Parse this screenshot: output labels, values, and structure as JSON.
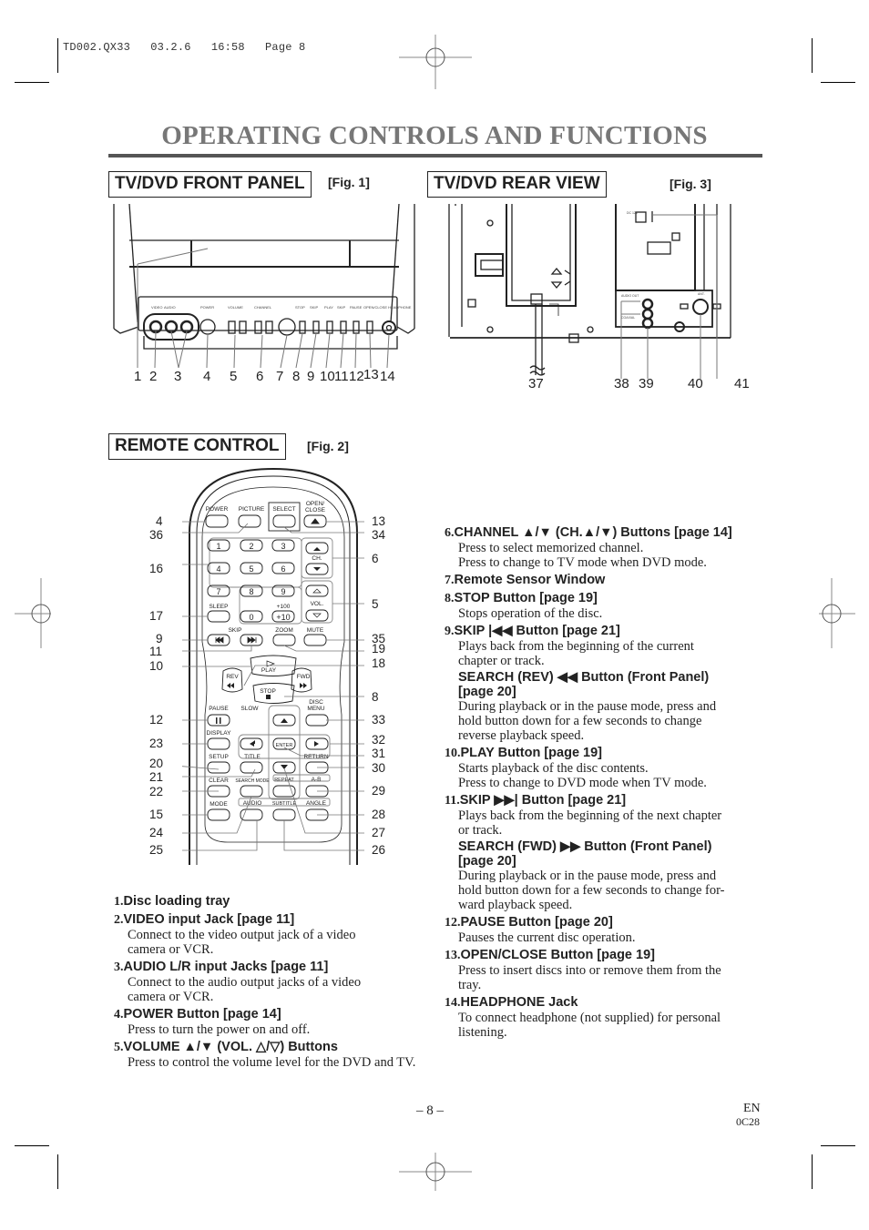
{
  "slug": "TD002.QX33   03.2.6   16:58   Page 8",
  "page_title": "OPERATING CONTROLS AND FUNCTIONS",
  "sections": {
    "front_panel": {
      "heading": "TV/DVD FRONT PANEL",
      "fig": "[Fig. 1]",
      "callouts": [
        "1",
        "2",
        "3",
        "4",
        "5",
        "6",
        "7",
        "8",
        "9",
        "10",
        "11",
        "12",
        "13",
        "14"
      ]
    },
    "rear_view": {
      "heading": "TV/DVD REAR VIEW",
      "fig": "[Fig. 3]",
      "callouts": [
        "37",
        "38",
        "39",
        "40",
        "41"
      ],
      "labels": {
        "dc": "DC 12V",
        "audio_out": "AUDIO OUT",
        "l": "L",
        "r": "R",
        "coaxial": "COAXIAL",
        "ant": "ANT."
      }
    },
    "remote": {
      "heading": "REMOTE CONTROL",
      "fig": "[Fig. 2]",
      "buttons": {
        "power": "POWER",
        "picture": "PICTURE",
        "select": "SELECT",
        "open_close_1": "OPEN/",
        "open_close_2": "CLOSE",
        "digits": [
          "1",
          "2",
          "3",
          "4",
          "5",
          "6",
          "7",
          "8",
          "9"
        ],
        "zero": "0",
        "plus10": "+10",
        "plus100": "+100",
        "sleep": "SLEEP",
        "ch": "CH.",
        "vol": "VOL.",
        "skip": "SKIP",
        "zoom": "ZOOM",
        "mute": "MUTE",
        "play": "PLAY",
        "rev": "REV",
        "fwd": "FWD",
        "stop": "STOP",
        "slow": "SLOW",
        "pause": "PAUSE",
        "disc_menu_1": "DISC",
        "disc_menu_2": "MENU",
        "display": "DISPLAY",
        "enter": "ENTER",
        "setup": "SETUP",
        "title": "TITLE",
        "return": "RETURN",
        "clear": "CLEAR",
        "search_mode": "SEARCH MODE",
        "repeat": "REPEAT",
        "ab": "A-B",
        "mode": "MODE",
        "audio": "AUDIO",
        "subtitle": "SUBTITLE",
        "angle": "ANGLE"
      },
      "left_callouts": [
        "4",
        "36",
        "16",
        "17",
        "9",
        "11",
        "10",
        "12",
        "23",
        "20",
        "21",
        "22",
        "15",
        "24",
        "25"
      ],
      "right_callouts": [
        "13",
        "34",
        "6",
        "5",
        "35",
        "19",
        "18",
        "8",
        "33",
        "32",
        "31",
        "30",
        "29",
        "28",
        "27",
        "26"
      ]
    }
  },
  "items_left": [
    {
      "num": "1.",
      "title": "Disc loading tray",
      "desc": []
    },
    {
      "num": "2.",
      "title": "VIDEO input Jack [page 11]",
      "desc": [
        "Connect to the video output jack of a video",
        "camera or VCR."
      ]
    },
    {
      "num": "3.",
      "title": "AUDIO L/R input Jacks [page 11]",
      "desc": [
        "Connect to the audio output jacks of a video",
        "camera or VCR."
      ]
    },
    {
      "num": "4.",
      "title": "POWER Button [page 14]",
      "desc": [
        "Press to turn the power on and off."
      ]
    },
    {
      "num": "5.",
      "title": "VOLUME ▲/▼ (VOL. △/▽) Buttons",
      "desc": [
        "Press to control the volume level for the DVD and TV."
      ]
    }
  ],
  "items_right": [
    {
      "num": "6.",
      "title": "CHANNEL ▲/▼ (CH.▲/▼) Buttons [page 14]",
      "desc": [
        "Press to select memorized channel.",
        "Press to change to TV mode when DVD mode."
      ]
    },
    {
      "num": "7.",
      "title": "Remote Sensor Window",
      "desc": []
    },
    {
      "num": "8.",
      "title": "STOP Button [page 19]",
      "desc": [
        "Stops operation of the disc."
      ]
    },
    {
      "num": "9.",
      "title": "SKIP |◀◀ Button  [page 21]",
      "desc": [
        "Plays back from the beginning of the current",
        "chapter or track."
      ],
      "sub_title": [
        "SEARCH (REV) ◀◀ Button (Front Panel)",
        "[page 20]"
      ],
      "sub_desc": [
        "During playback or in the pause mode, press and",
        "hold button down for a few seconds to change",
        "reverse playback speed."
      ]
    },
    {
      "num": "10.",
      "title": "PLAY Button [page 19]",
      "desc": [
        "Starts playback of the disc contents.",
        "Press to change to DVD mode when TV mode."
      ]
    },
    {
      "num": "11.",
      "title": "SKIP ▶▶| Button [page 21]",
      "desc": [
        "Plays back from the beginning of the next chapter",
        "or track."
      ],
      "sub_title": [
        "SEARCH (FWD) ▶▶ Button (Front Panel)",
        "[page 20]"
      ],
      "sub_desc": [
        "During playback or in the pause mode, press and",
        "hold button down for a few seconds to change for-",
        "ward playback speed."
      ]
    },
    {
      "num": "12.",
      "title": "PAUSE Button [page 20]",
      "desc": [
        "Pauses the current disc operation."
      ]
    },
    {
      "num": "13.",
      "title": "OPEN/CLOSE Button [page 19]",
      "desc": [
        "Press to insert discs into or remove them from the",
        "tray."
      ]
    },
    {
      "num": "14.",
      "title": "HEADPHONE Jack",
      "desc": [
        "To connect headphone (not supplied) for personal",
        "listening."
      ]
    }
  ],
  "footer": {
    "page_number": "– 8 –",
    "lang": "EN",
    "code": "0C28"
  }
}
